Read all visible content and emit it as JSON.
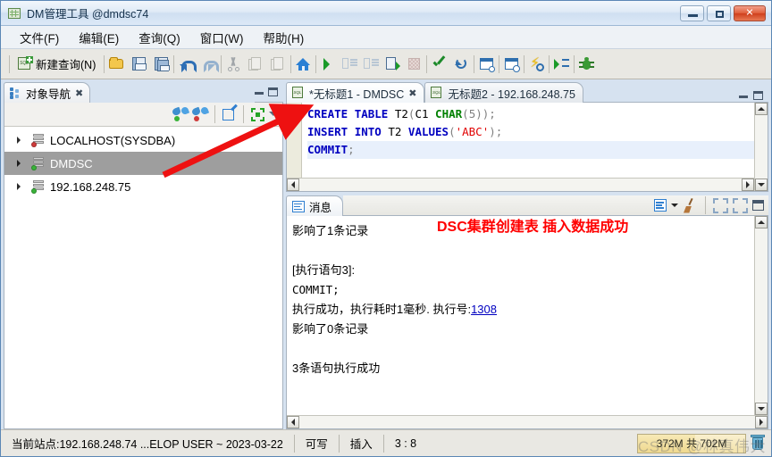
{
  "window": {
    "title": "DM管理工具 @dmdsc74",
    "icon": "app-grid-icon",
    "buttons": {
      "minimize": "–",
      "maximize": "□",
      "close": "✕"
    }
  },
  "menu": {
    "items": [
      {
        "label": "文件(F)",
        "text": "文件",
        "accel": "F"
      },
      {
        "label": "编辑(E)",
        "text": "编辑",
        "accel": "E"
      },
      {
        "label": "查询(Q)",
        "text": "查询",
        "accel": "Q"
      },
      {
        "label": "窗口(W)",
        "text": "窗口",
        "accel": "W"
      },
      {
        "label": "帮助(H)",
        "text": "帮助",
        "accel": "H"
      }
    ]
  },
  "toolbar": {
    "new_query_label": "新建查询(N)",
    "items": [
      {
        "name": "new-query-button",
        "label": "新建查询(N)",
        "enabled": true
      },
      {
        "name": "open-file-icon",
        "label": "打开",
        "enabled": true
      },
      {
        "name": "save-icon",
        "label": "保存",
        "enabled": true
      },
      {
        "name": "save-all-icon",
        "label": "全部保存",
        "enabled": true
      },
      {
        "name": "undo-icon",
        "label": "撤销",
        "enabled": true
      },
      {
        "name": "redo-icon",
        "label": "重做",
        "enabled": true
      },
      {
        "name": "cut-icon",
        "label": "剪切",
        "enabled": false
      },
      {
        "name": "copy-icon",
        "label": "复制",
        "enabled": false
      },
      {
        "name": "paste-icon",
        "label": "粘贴",
        "enabled": false
      },
      {
        "name": "home-icon",
        "label": "主页",
        "enabled": true
      },
      {
        "name": "execute-icon",
        "label": "执行",
        "enabled": true
      },
      {
        "name": "execute-indent-icon",
        "label": "执行并缩进",
        "enabled": false
      },
      {
        "name": "execute-outdent-icon",
        "label": "执行并取消缩进",
        "enabled": false
      },
      {
        "name": "execute-script-icon",
        "label": "执行脚本",
        "enabled": true
      },
      {
        "name": "stop-icon",
        "label": "停止",
        "enabled": false
      },
      {
        "name": "commit-icon",
        "label": "提交",
        "enabled": true
      },
      {
        "name": "rollback-icon",
        "label": "回滚",
        "enabled": true
      },
      {
        "name": "explain-plan-icon",
        "label": "执行计划",
        "enabled": true
      },
      {
        "name": "history-plan-icon",
        "label": "历史计划",
        "enabled": true
      },
      {
        "name": "analyze-icon",
        "label": "分析",
        "enabled": true
      },
      {
        "name": "run-to-icon",
        "label": "单步执行",
        "enabled": true
      },
      {
        "name": "debug-icon",
        "label": "调试",
        "enabled": true
      }
    ]
  },
  "sidebar": {
    "tab": {
      "label": "对象导航",
      "close": "✖"
    },
    "panel_buttons": {
      "minimize": "minimize",
      "maximize": "maximize"
    },
    "tools": [
      {
        "name": "connect-icon",
        "label": "连接"
      },
      {
        "name": "disconnect-icon",
        "label": "断开连接"
      },
      {
        "name": "edit-icon",
        "label": "编辑"
      },
      {
        "name": "collapse-all-icon",
        "label": "全部折叠"
      },
      {
        "name": "view-menu-icon",
        "label": "视图菜单"
      }
    ],
    "tree": [
      {
        "label": "LOCALHOST(SYSDBA)",
        "status": "red",
        "selected": false
      },
      {
        "label": "DMDSC",
        "status": "green",
        "selected": true
      },
      {
        "label": "192.168.248.75",
        "status": "green",
        "selected": false
      }
    ]
  },
  "editor": {
    "tabs": [
      {
        "label": "*无标题1 - DMDSC",
        "active": true,
        "close": "✖"
      },
      {
        "label": "无标题2 - 192.168.248.75",
        "active": false
      }
    ],
    "lines": [
      {
        "current": false,
        "tokens": [
          {
            "t": "CREATE",
            "c": "kw"
          },
          {
            "t": " ",
            "c": "id"
          },
          {
            "t": "TABLE",
            "c": "kw"
          },
          {
            "t": " ",
            "c": "id"
          },
          {
            "t": "T2",
            "c": "id"
          },
          {
            "t": "(",
            "c": "pn"
          },
          {
            "t": "C1",
            "c": "id"
          },
          {
            "t": " ",
            "c": "id"
          },
          {
            "t": "CHAR",
            "c": "ty"
          },
          {
            "t": "(",
            "c": "pn"
          },
          {
            "t": "5",
            "c": "num"
          },
          {
            "t": "))",
            "c": "pn"
          },
          {
            "t": ";",
            "c": "pn"
          }
        ]
      },
      {
        "current": false,
        "tokens": [
          {
            "t": "INSERT",
            "c": "kw"
          },
          {
            "t": " ",
            "c": "id"
          },
          {
            "t": "INTO",
            "c": "kw"
          },
          {
            "t": " ",
            "c": "id"
          },
          {
            "t": "T2",
            "c": "id"
          },
          {
            "t": " ",
            "c": "id"
          },
          {
            "t": "VALUES",
            "c": "kw"
          },
          {
            "t": "(",
            "c": "pn"
          },
          {
            "t": "'ABC'",
            "c": "str"
          },
          {
            "t": ")",
            "c": "pn"
          },
          {
            "t": ";",
            "c": "pn"
          }
        ]
      },
      {
        "current": true,
        "tokens": [
          {
            "t": "COMMIT",
            "c": "kw"
          },
          {
            "t": ";",
            "c": "pn"
          }
        ]
      }
    ]
  },
  "messages": {
    "tab": {
      "label": "消息"
    },
    "tools": [
      {
        "name": "message-view-icon",
        "label": "视图"
      },
      {
        "name": "view-dropdown-icon",
        "label": "下拉"
      },
      {
        "name": "clear-messages-icon",
        "label": "清空消息"
      },
      {
        "name": "minimize-panel-icon",
        "label": "最小化",
        "enabled": false
      },
      {
        "name": "restore-panel-icon",
        "label": "还原",
        "enabled": false
      },
      {
        "name": "maximize-panel-icon",
        "label": "最大化",
        "enabled": true
      }
    ],
    "annotation": "DSC集群创建表 插入数据成功",
    "annotation_color": "#ff0000",
    "lines": [
      {
        "text": "影响了1条记录",
        "mono": false
      },
      {
        "text": "",
        "mono": false
      },
      {
        "text": "[执行语句3]:",
        "mono": false
      },
      {
        "text": "COMMIT;",
        "mono": true
      },
      {
        "text": "执行成功，执行耗时1毫秒. 执行号:",
        "mono": false,
        "link": "1308"
      },
      {
        "text": "影响了0条记录",
        "mono": false
      },
      {
        "text": "",
        "mono": false
      },
      {
        "text": "3条语句执行成功",
        "mono": false
      }
    ]
  },
  "statusbar": {
    "site": "当前站点:192.168.248.74  ...ELOP USER ~ 2023-03-22",
    "writable": "可写",
    "insert_mode": "插入",
    "position": "3 : 8",
    "memory": "372M 共 702M",
    "memory_used_percent": 53,
    "trash_icon": "trash-icon",
    "watermark": "CSDN @林真伟大"
  }
}
